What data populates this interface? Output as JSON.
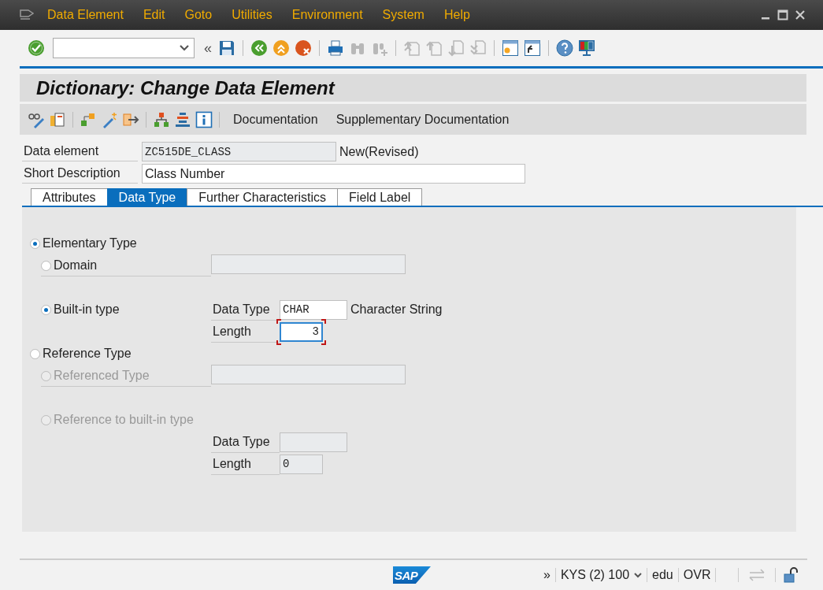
{
  "menu_bar": {
    "items": [
      "Data Element",
      "Edit",
      "Goto",
      "Utilities",
      "Environment",
      "System",
      "Help"
    ]
  },
  "toolbar": {
    "more": "«"
  },
  "title": "Dictionary: Change Data Element",
  "app_toolbar": {
    "buttons": [
      "Documentation",
      "Supplementary Documentation"
    ]
  },
  "header_fields": [
    {
      "label": "Data element",
      "value": "ZC515DE_CLASS",
      "editable": false,
      "note": "New(Revised)"
    },
    {
      "label": "Short Description",
      "value": "Class Number",
      "editable": true
    }
  ],
  "tabs": [
    {
      "label": "Attributes",
      "selected": false
    },
    {
      "label": "Data Type",
      "selected": true
    },
    {
      "label": "Further Characteristics",
      "selected": false
    },
    {
      "label": "Field Label",
      "selected": false
    }
  ],
  "type_groups": [
    {
      "label": "Elementary Type",
      "selected": true,
      "disabled": false,
      "children": [
        {
          "label": "Domain",
          "selected": false,
          "disabled": false,
          "kind": "inline",
          "fields": [
            {
              "editable": false
            }
          ]
        },
        {
          "label": "Built-in type",
          "selected": true,
          "disabled": false,
          "kind": "side",
          "fields": [
            {
              "label": "Data Type",
              "value": "CHAR",
              "editable": true,
              "note": "Character String"
            },
            {
              "label": "Length",
              "value": "3",
              "editable": true,
              "focused": true
            }
          ]
        }
      ]
    },
    {
      "label": "Reference Type",
      "selected": false,
      "disabled": false,
      "children": [
        {
          "label": "Referenced Type",
          "selected": false,
          "disabled": true,
          "kind": "inline",
          "fields": [
            {
              "editable": false
            }
          ]
        },
        {
          "label": "Reference to built-in type",
          "selected": false,
          "disabled": true,
          "kind": "below",
          "fields": [
            {
              "label": "Data Type",
              "editable": false
            },
            {
              "label": "Length",
              "value": "0",
              "editable": false
            }
          ]
        }
      ]
    }
  ],
  "status_bar": {
    "logo": "SAP",
    "expand": "»",
    "system": "KYS (2) 100",
    "client": "edu",
    "mode": "OVR"
  }
}
